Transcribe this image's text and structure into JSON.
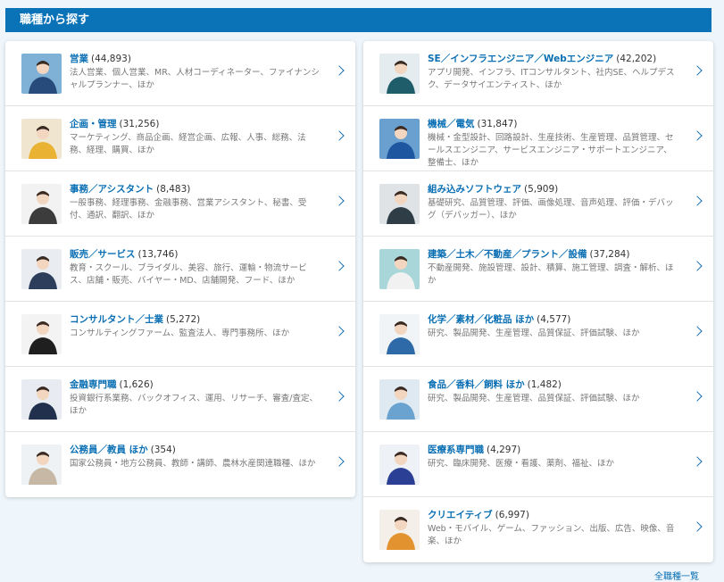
{
  "header": {
    "title": "職種から探す"
  },
  "left": [
    {
      "title": "営業",
      "count": "(44,893)",
      "desc": "法人営業、個人営業、MR、人材コーディネーター、ファイナンシャルプランナー、ほか",
      "icon": "businessman-phone-photo-icon",
      "bg": "#7fb0d6",
      "fg": "#274b7a"
    },
    {
      "title": "企画・管理",
      "count": "(31,256)",
      "desc": "マーケティング、商品企画、経営企画、広報、人事、総務、法務、経理、購買、ほか",
      "icon": "woman-planner-photo-icon",
      "bg": "#f0e6cf",
      "fg": "#e9b233"
    },
    {
      "title": "事務／アシスタント",
      "count": "(8,483)",
      "desc": "一般事務、経理事務、金融事務、営業アシスタント、秘書、受付、通訳、翻訳、ほか",
      "icon": "office-assistant-photo-icon",
      "bg": "#f2f2f2",
      "fg": "#3c3c3c"
    },
    {
      "title": "販売／サービス",
      "count": "(13,746)",
      "desc": "教育・スクール、ブライダル、美容、旅行、運輸・物流サービス、店舗・販売、バイヤー・MD、店舗開発、フード、ほか",
      "icon": "sales-staff-photo-icon",
      "bg": "#e9edf2",
      "fg": "#2c3e5c"
    },
    {
      "title": "コンサルタント／士業",
      "count": "(5,272)",
      "desc": "コンサルティングファーム、監査法人、専門事務所、ほか",
      "icon": "consultant-photo-icon",
      "bg": "#f3f3f3",
      "fg": "#1f1f1f"
    },
    {
      "title": "金融専門職",
      "count": "(1,626)",
      "desc": "投資銀行系業務、バックオフィス、運用、リサーチ、審査/査定、ほか",
      "icon": "finance-professional-photo-icon",
      "bg": "#e8ecf2",
      "fg": "#20304d"
    },
    {
      "title": "公務員／教員 ほか",
      "count": "(354)",
      "desc": "国家公務員・地方公務員、教師・講師、農林水産関連職種、ほか",
      "icon": "teacher-photo-icon",
      "bg": "#eef2f5",
      "fg": "#c7b8a5"
    }
  ],
  "right": [
    {
      "title": "SE／インフラエンジニア／Webエンジニア",
      "count": "(42,202)",
      "desc": "アプリ開発、インフラ、ITコンサルタント、社内SE、ヘルプデスク、データサイエンティスト、ほか",
      "icon": "engineer-laptop-photo-icon",
      "bg": "#e5ecef",
      "fg": "#1f5d6b"
    },
    {
      "title": "機械／電気",
      "count": "(31,847)",
      "desc": "機械・金型設計、回路設計、生産技術、生産管理、品質管理、セールスエンジニア、サービスエンジニア・サポートエンジニア、整備士、ほか",
      "icon": "mechanical-engineer-photo-icon",
      "bg": "#6aa0d0",
      "fg": "#1f56a0"
    },
    {
      "title": "組み込みソフトウェア",
      "count": "(5,909)",
      "desc": "基礎研究、品質管理、評価、画像処理、音声処理、評価・デバッグ（デバッガー）、ほか",
      "icon": "embedded-software-photo-icon",
      "bg": "#dfe3e6",
      "fg": "#2e3d46"
    },
    {
      "title": "建築／土木／不動産／プラント／設備",
      "count": "(37,284)",
      "desc": "不動産開発、施設管理、設計、積算、施工管理、調査・解析、ほか",
      "icon": "construction-worker-photo-icon",
      "bg": "#a9d6d8",
      "fg": "#f1f1f1"
    },
    {
      "title": "化学／素材／化粧品 ほか",
      "count": "(4,577)",
      "desc": "研究、製品開発、生産管理、品質保証、評価試験、ほか",
      "icon": "chemist-photo-icon",
      "bg": "#f1f4f6",
      "fg": "#2e6aa8"
    },
    {
      "title": "食品／香料／飼料 ほか",
      "count": "(1,482)",
      "desc": "研究、製品開発、生産管理、品質保証、評価試験、ほか",
      "icon": "food-researcher-photo-icon",
      "bg": "#dfe9f1",
      "fg": "#6aa3cf"
    },
    {
      "title": "医療系専門職",
      "count": "(4,297)",
      "desc": "研究、臨床開発、医療・看護、薬剤、福祉、ほか",
      "icon": "medical-staff-photo-icon",
      "bg": "#eef2f6",
      "fg": "#2b3f95"
    },
    {
      "title": "クリエイティブ",
      "count": "(6,997)",
      "desc": "Web・モバイル、ゲーム、ファッション、出版、広告、映像、音楽、ほか",
      "icon": "creative-designer-photo-icon",
      "bg": "#f4efe8",
      "fg": "#e2932f"
    }
  ],
  "footer": {
    "more_link": "全職種一覧"
  }
}
